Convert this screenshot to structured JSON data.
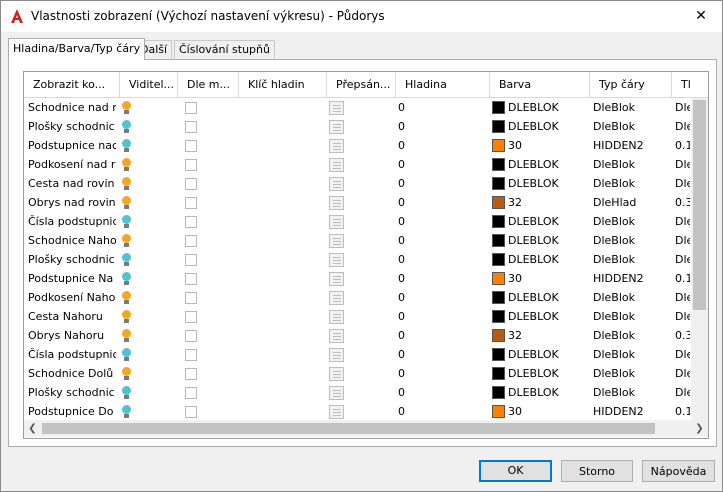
{
  "window": {
    "title": "Vlastnosti zobrazení (Výchozí nastavení výkresu) - Půdorys",
    "close_glyph": "✕",
    "app_icon": "autocad-a-icon"
  },
  "tabs": [
    "Hladina/Barva/Typ čáry",
    "Další",
    "Číslování stupňů"
  ],
  "grid": {
    "columns": [
      "Zobrazit ko...",
      "Viditel...",
      "Dle m...",
      "Klíč hladin",
      "Přepsán...",
      "Hladina",
      "Barva",
      "Typ čáry",
      "Tl"
    ],
    "rows": [
      {
        "name": "Schodnice nad r",
        "bulb": "on",
        "layer": "0",
        "color": "DLEBLOK",
        "swatch": "#000000",
        "linetype": "DleBlok",
        "lw": "Dle"
      },
      {
        "name": "Plošky schodnic",
        "bulb": "off",
        "layer": "0",
        "color": "DLEBLOK",
        "swatch": "#000000",
        "linetype": "DleBlok",
        "lw": "Dle"
      },
      {
        "name": "Podstupnice nac",
        "bulb": "off",
        "layer": "0",
        "color": "30",
        "swatch": "#ff7f00",
        "linetype": "HIDDEN2",
        "lw": "0.1"
      },
      {
        "name": "Podkosení nad r",
        "bulb": "on",
        "layer": "0",
        "color": "DLEBLOK",
        "swatch": "#000000",
        "linetype": "DleBlok",
        "lw": "Dle"
      },
      {
        "name": "Cesta nad rovin",
        "bulb": "on",
        "layer": "0",
        "color": "DLEBLOK",
        "swatch": "#000000",
        "linetype": "DleBlok",
        "lw": "Dle"
      },
      {
        "name": "Obrys nad rovin",
        "bulb": "on",
        "layer": "0",
        "color": "32",
        "swatch": "#b85a10",
        "linetype": "DleHlad",
        "lw": "0.3"
      },
      {
        "name": "Čísla podstupnic",
        "bulb": "off",
        "layer": "0",
        "color": "DLEBLOK",
        "swatch": "#000000",
        "linetype": "DleBlok",
        "lw": "Dle"
      },
      {
        "name": "Schodnice Naho",
        "bulb": "on",
        "layer": "0",
        "color": "DLEBLOK",
        "swatch": "#000000",
        "linetype": "DleBlok",
        "lw": "Dle"
      },
      {
        "name": "Plošky schodnic",
        "bulb": "off",
        "layer": "0",
        "color": "DLEBLOK",
        "swatch": "#000000",
        "linetype": "DleBlok",
        "lw": "Dle"
      },
      {
        "name": "Podstupnice Na",
        "bulb": "off",
        "layer": "0",
        "color": "30",
        "swatch": "#ff7f00",
        "linetype": "HIDDEN2",
        "lw": "0.1"
      },
      {
        "name": "Podkosení Naho",
        "bulb": "on",
        "layer": "0",
        "color": "DLEBLOK",
        "swatch": "#000000",
        "linetype": "DleBlok",
        "lw": "Dle"
      },
      {
        "name": "Cesta Nahoru",
        "bulb": "on",
        "layer": "0",
        "color": "DLEBLOK",
        "swatch": "#000000",
        "linetype": "DleBlok",
        "lw": "Dle"
      },
      {
        "name": "Obrys Nahoru",
        "bulb": "on",
        "layer": "0",
        "color": "32",
        "swatch": "#b85a10",
        "linetype": "DleBlok",
        "lw": "0.3"
      },
      {
        "name": "Čísla podstupnic",
        "bulb": "off",
        "layer": "0",
        "color": "DLEBLOK",
        "swatch": "#000000",
        "linetype": "DleBlok",
        "lw": "Dle"
      },
      {
        "name": "Schodnice Dolů",
        "bulb": "on",
        "layer": "0",
        "color": "DLEBLOK",
        "swatch": "#000000",
        "linetype": "DleBlok",
        "lw": "Dle"
      },
      {
        "name": "Plošky schodnic",
        "bulb": "off",
        "layer": "0",
        "color": "DLEBLOK",
        "swatch": "#000000",
        "linetype": "DleBlok",
        "lw": "Dle"
      },
      {
        "name": "Podstupnice Do",
        "bulb": "off",
        "layer": "0",
        "color": "30",
        "swatch": "#ff7f00",
        "linetype": "HIDDEN2",
        "lw": "0.1"
      }
    ]
  },
  "colors": {
    "bulb_on": "#f5a623",
    "bulb_off": "#4fc3d0",
    "default_button_border": "#0078d7"
  },
  "buttons": {
    "ok": "OK",
    "cancel": "Storno",
    "help": "Nápověda"
  }
}
